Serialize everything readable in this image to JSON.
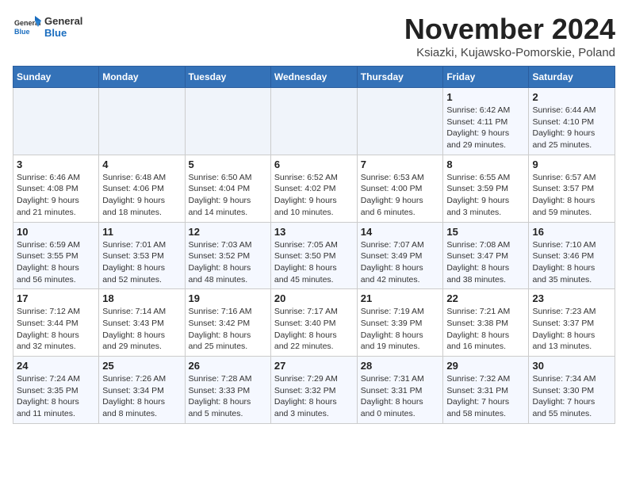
{
  "header": {
    "logo_general": "General",
    "logo_blue": "Blue",
    "title": "November 2024",
    "subtitle": "Ksiazki, Kujawsko-Pomorskie, Poland"
  },
  "days_of_week": [
    "Sunday",
    "Monday",
    "Tuesday",
    "Wednesday",
    "Thursday",
    "Friday",
    "Saturday"
  ],
  "weeks": [
    [
      {
        "day": "",
        "info": ""
      },
      {
        "day": "",
        "info": ""
      },
      {
        "day": "",
        "info": ""
      },
      {
        "day": "",
        "info": ""
      },
      {
        "day": "",
        "info": ""
      },
      {
        "day": "1",
        "info": "Sunrise: 6:42 AM\nSunset: 4:11 PM\nDaylight: 9 hours\nand 29 minutes."
      },
      {
        "day": "2",
        "info": "Sunrise: 6:44 AM\nSunset: 4:10 PM\nDaylight: 9 hours\nand 25 minutes."
      }
    ],
    [
      {
        "day": "3",
        "info": "Sunrise: 6:46 AM\nSunset: 4:08 PM\nDaylight: 9 hours\nand 21 minutes."
      },
      {
        "day": "4",
        "info": "Sunrise: 6:48 AM\nSunset: 4:06 PM\nDaylight: 9 hours\nand 18 minutes."
      },
      {
        "day": "5",
        "info": "Sunrise: 6:50 AM\nSunset: 4:04 PM\nDaylight: 9 hours\nand 14 minutes."
      },
      {
        "day": "6",
        "info": "Sunrise: 6:52 AM\nSunset: 4:02 PM\nDaylight: 9 hours\nand 10 minutes."
      },
      {
        "day": "7",
        "info": "Sunrise: 6:53 AM\nSunset: 4:00 PM\nDaylight: 9 hours\nand 6 minutes."
      },
      {
        "day": "8",
        "info": "Sunrise: 6:55 AM\nSunset: 3:59 PM\nDaylight: 9 hours\nand 3 minutes."
      },
      {
        "day": "9",
        "info": "Sunrise: 6:57 AM\nSunset: 3:57 PM\nDaylight: 8 hours\nand 59 minutes."
      }
    ],
    [
      {
        "day": "10",
        "info": "Sunrise: 6:59 AM\nSunset: 3:55 PM\nDaylight: 8 hours\nand 56 minutes."
      },
      {
        "day": "11",
        "info": "Sunrise: 7:01 AM\nSunset: 3:53 PM\nDaylight: 8 hours\nand 52 minutes."
      },
      {
        "day": "12",
        "info": "Sunrise: 7:03 AM\nSunset: 3:52 PM\nDaylight: 8 hours\nand 48 minutes."
      },
      {
        "day": "13",
        "info": "Sunrise: 7:05 AM\nSunset: 3:50 PM\nDaylight: 8 hours\nand 45 minutes."
      },
      {
        "day": "14",
        "info": "Sunrise: 7:07 AM\nSunset: 3:49 PM\nDaylight: 8 hours\nand 42 minutes."
      },
      {
        "day": "15",
        "info": "Sunrise: 7:08 AM\nSunset: 3:47 PM\nDaylight: 8 hours\nand 38 minutes."
      },
      {
        "day": "16",
        "info": "Sunrise: 7:10 AM\nSunset: 3:46 PM\nDaylight: 8 hours\nand 35 minutes."
      }
    ],
    [
      {
        "day": "17",
        "info": "Sunrise: 7:12 AM\nSunset: 3:44 PM\nDaylight: 8 hours\nand 32 minutes."
      },
      {
        "day": "18",
        "info": "Sunrise: 7:14 AM\nSunset: 3:43 PM\nDaylight: 8 hours\nand 29 minutes."
      },
      {
        "day": "19",
        "info": "Sunrise: 7:16 AM\nSunset: 3:42 PM\nDaylight: 8 hours\nand 25 minutes."
      },
      {
        "day": "20",
        "info": "Sunrise: 7:17 AM\nSunset: 3:40 PM\nDaylight: 8 hours\nand 22 minutes."
      },
      {
        "day": "21",
        "info": "Sunrise: 7:19 AM\nSunset: 3:39 PM\nDaylight: 8 hours\nand 19 minutes."
      },
      {
        "day": "22",
        "info": "Sunrise: 7:21 AM\nSunset: 3:38 PM\nDaylight: 8 hours\nand 16 minutes."
      },
      {
        "day": "23",
        "info": "Sunrise: 7:23 AM\nSunset: 3:37 PM\nDaylight: 8 hours\nand 13 minutes."
      }
    ],
    [
      {
        "day": "24",
        "info": "Sunrise: 7:24 AM\nSunset: 3:35 PM\nDaylight: 8 hours\nand 11 minutes."
      },
      {
        "day": "25",
        "info": "Sunrise: 7:26 AM\nSunset: 3:34 PM\nDaylight: 8 hours\nand 8 minutes."
      },
      {
        "day": "26",
        "info": "Sunrise: 7:28 AM\nSunset: 3:33 PM\nDaylight: 8 hours\nand 5 minutes."
      },
      {
        "day": "27",
        "info": "Sunrise: 7:29 AM\nSunset: 3:32 PM\nDaylight: 8 hours\nand 3 minutes."
      },
      {
        "day": "28",
        "info": "Sunrise: 7:31 AM\nSunset: 3:31 PM\nDaylight: 8 hours\nand 0 minutes."
      },
      {
        "day": "29",
        "info": "Sunrise: 7:32 AM\nSunset: 3:31 PM\nDaylight: 7 hours\nand 58 minutes."
      },
      {
        "day": "30",
        "info": "Sunrise: 7:34 AM\nSunset: 3:30 PM\nDaylight: 7 hours\nand 55 minutes."
      }
    ]
  ]
}
